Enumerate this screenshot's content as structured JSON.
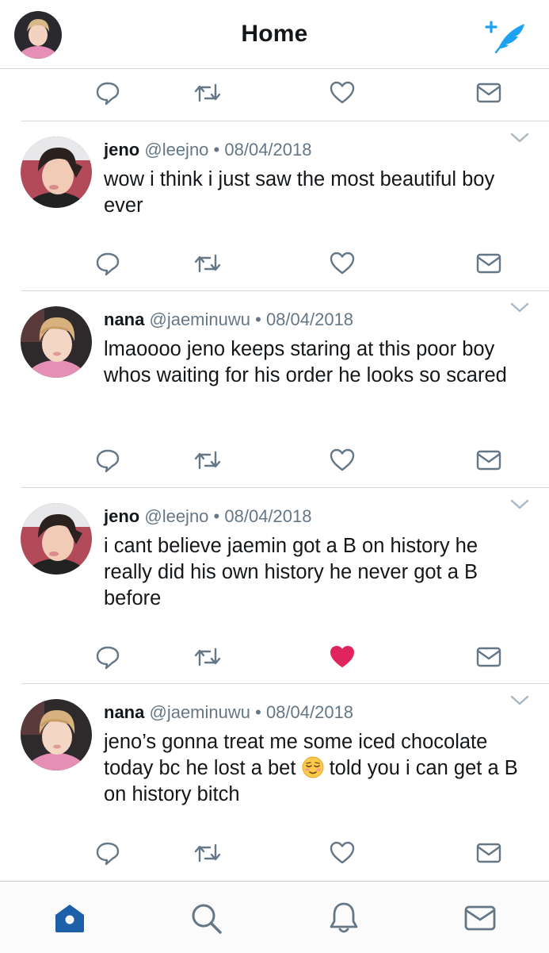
{
  "header": {
    "title": "Home"
  },
  "tweets": [
    {
      "name": "jeno",
      "handle": "@leejno",
      "separator": "•",
      "date": "08/04/2018",
      "text": "wow i think i just saw the most beautiful boy ever",
      "liked": false,
      "avatar": "jeno"
    },
    {
      "name": "nana",
      "handle": "@jaeminuwu",
      "separator": "•",
      "date": "08/04/2018",
      "text": "lmaoooo jeno keeps staring at this poor boy whos waiting for his order he looks so scared",
      "liked": false,
      "avatar": "nana"
    },
    {
      "name": "jeno",
      "handle": "@leejno",
      "separator": "•",
      "date": "08/04/2018",
      "text": "i cant believe jaemin got a B on history he really did his own history he never got a B before",
      "liked": true,
      "avatar": "jeno"
    },
    {
      "name": "nana",
      "handle": "@jaeminuwu",
      "separator": "•",
      "date": "08/04/2018",
      "text_before_emoji": "jeno’s gonna treat me some iced chocolate today bc he lost a bet ",
      "emoji": "relieved-face-emoji",
      "text_after_emoji": " told you i can get a B on history bitch",
      "liked": false,
      "avatar": "nana"
    }
  ],
  "icons": {
    "reply": "reply-icon",
    "retweet": "retweet-icon",
    "like": "heart-icon",
    "dm": "envelope-icon",
    "compose": "compose-tweet-icon",
    "caret": "chevron-down-icon",
    "tab_home": "home-icon",
    "tab_search": "search-icon",
    "tab_notifications": "bell-icon",
    "tab_messages": "envelope-icon"
  },
  "colors": {
    "accent": "#1da1f2",
    "tab_active": "#1d5fa8",
    "icon_gray": "#657786",
    "like_red": "#e0245e"
  },
  "active_tab": "home"
}
